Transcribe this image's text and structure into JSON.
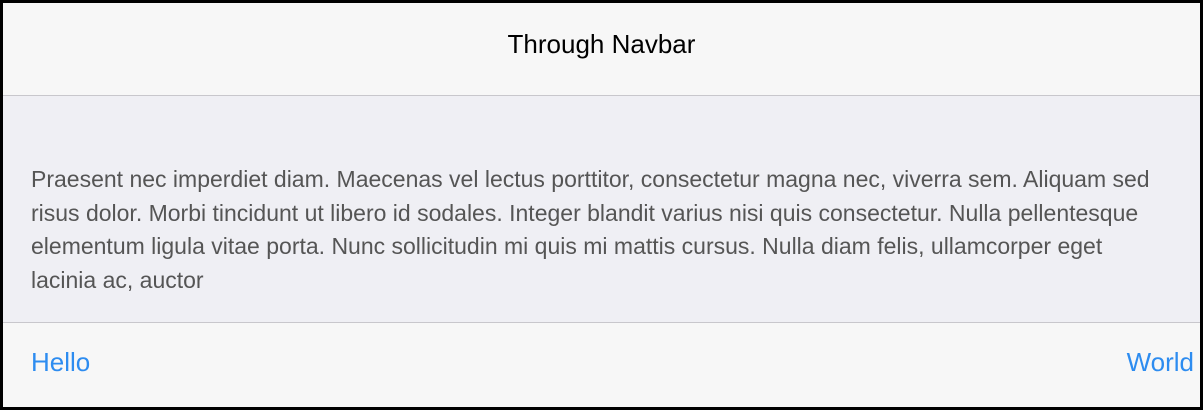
{
  "navbar": {
    "title": "Through Navbar"
  },
  "content": {
    "paragraph": "Praesent nec imperdiet diam. Maecenas vel lectus porttitor, consectetur magna nec, viverra sem. Aliquam sed risus dolor. Morbi tincidunt ut libero id sodales. Integer blandit varius nisi quis consectetur. Nulla pellentesque elementum ligula vitae porta. Nunc sollicitudin mi quis mi mattis cursus. Nulla diam felis, ullamcorper eget lacinia ac, auctor"
  },
  "toolbar": {
    "left_link": "Hello",
    "right_link": "World"
  },
  "colors": {
    "link": "#2d8cf0",
    "bar_background": "#f7f7f7",
    "content_background": "#efeff4",
    "body_text": "#555555"
  }
}
